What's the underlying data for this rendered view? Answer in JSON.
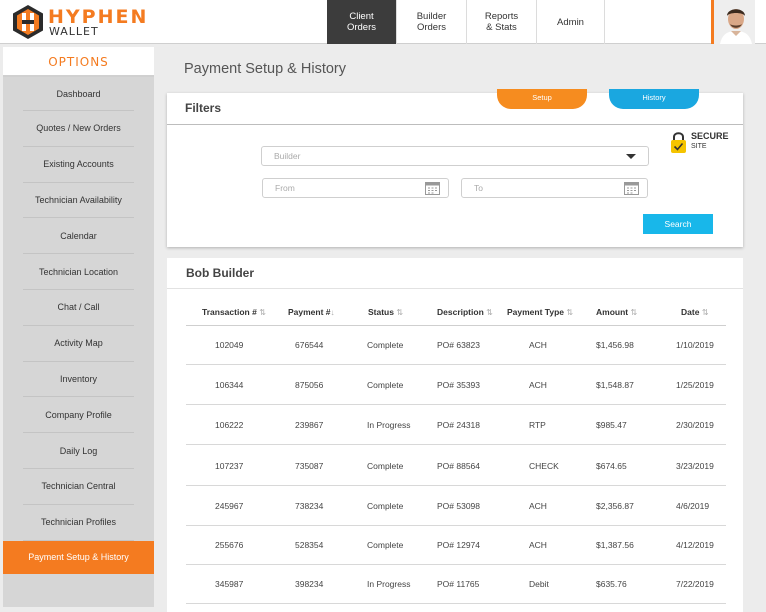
{
  "brand": {
    "name": "HYPHEN",
    "sub": "WALLET"
  },
  "nav": [
    {
      "label": "Client\nOrders",
      "active": true
    },
    {
      "label": "Builder\nOrders",
      "active": false
    },
    {
      "label": "Reports\n& Stats",
      "active": false
    },
    {
      "label": "Admin",
      "active": false
    }
  ],
  "sidebar": {
    "heading": "OPTIONS",
    "items": [
      "Dashboard",
      "Quotes / New Orders",
      "Existing Accounts",
      "Technician Availability",
      "Calendar",
      "Technician Location",
      "Chat / Call",
      "Activity Map",
      "Inventory",
      "Company Profile",
      "Daily Log",
      "Technician Central",
      "Technician Profiles",
      "Payment Setup & History"
    ],
    "active_index": 13
  },
  "page": {
    "title": "Payment Setup & History"
  },
  "filters": {
    "title": "Filters",
    "tabs": {
      "setup": "Setup",
      "history": "History"
    },
    "secure": {
      "line1": "SECURE",
      "line2": "SITE"
    },
    "builder_placeholder": "Builder",
    "from_placeholder": "From",
    "to_placeholder": "To",
    "search_label": "Search"
  },
  "table": {
    "title": "Bob Builder",
    "columns": [
      "Transaction #",
      "Payment #",
      "Status",
      "Description",
      "Payment Type",
      "Amount",
      "Date"
    ],
    "rows": [
      [
        "102049",
        "676544",
        "Complete",
        "PO# 63823",
        "ACH",
        "$1,456.98",
        "1/10/2019"
      ],
      [
        "106344",
        "875056",
        "Complete",
        "PO# 35393",
        "ACH",
        "$1,548.87",
        "1/25/2019"
      ],
      [
        "106222",
        "239867",
        "In Progress",
        "PO# 24318",
        "RTP",
        "$985.47",
        "2/30/2019"
      ],
      [
        "107237",
        "735087",
        "Complete",
        "PO# 88564",
        "CHECK",
        "$674.65",
        "3/23/2019"
      ],
      [
        "245967",
        "738234",
        "Complete",
        "PO# 53098",
        "ACH",
        "$2,356.87",
        "4/6/2019"
      ],
      [
        "255676",
        "528354",
        "Complete",
        "PO# 12974",
        "ACH",
        "$1,387.56",
        "4/12/2019"
      ],
      [
        "345987",
        "398234",
        "In Progress",
        "PO# 11765",
        "Debit",
        "$635.76",
        "7/22/2019"
      ]
    ]
  },
  "colors": {
    "accent": "#f47b20",
    "blue": "#18b7ea",
    "nav_active": "#3c3c3c"
  },
  "icons": [
    "hexagon-logo-icon",
    "user-avatar",
    "lock-icon",
    "calendar-icon",
    "sort-icon",
    "dropdown-caret-icon"
  ]
}
